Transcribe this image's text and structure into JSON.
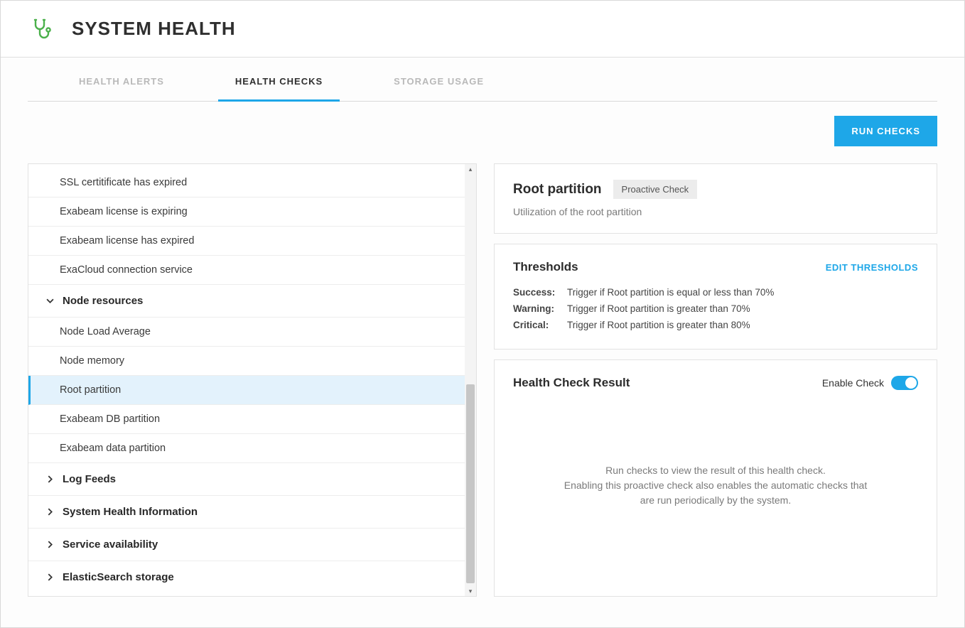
{
  "header": {
    "title": "SYSTEM HEALTH"
  },
  "tabs": [
    {
      "label": "HEALTH ALERTS",
      "active": false
    },
    {
      "label": "HEALTH CHECKS",
      "active": true
    },
    {
      "label": "STORAGE USAGE",
      "active": false
    }
  ],
  "actions": {
    "run_checks": "RUN CHECKS"
  },
  "tree": {
    "leading_leaves": [
      "SSL certitificate has expired",
      "Exabeam license is expiring",
      "Exabeam license has expired",
      "ExaCloud connection service"
    ],
    "group_node_resources": {
      "label": "Node resources",
      "expanded": true,
      "children": [
        "Node Load Average",
        "Node memory",
        "Root partition",
        "Exabeam DB partition",
        "Exabeam data partition"
      ],
      "selected_index": 2
    },
    "closed_groups": [
      "Log Feeds",
      "System Health Information",
      "Service availability",
      "ElasticSearch storage"
    ]
  },
  "detail": {
    "title": "Root partition",
    "badge": "Proactive Check",
    "subtitle": "Utilization of the root partition"
  },
  "thresholds": {
    "title": "Thresholds",
    "edit_label": "EDIT THRESHOLDS",
    "rows": [
      {
        "label": "Success:",
        "text": "Trigger if Root partition is equal or less than 70%"
      },
      {
        "label": "Warning:",
        "text": "Trigger if Root partition is greater than 70%"
      },
      {
        "label": "Critical:",
        "text": "Trigger if Root partition is greater than 80%"
      }
    ]
  },
  "result": {
    "title": "Health Check Result",
    "toggle_label": "Enable Check",
    "toggle_on": true,
    "placeholder_line1": "Run checks to view the result of this health check.",
    "placeholder_line2": "Enabling this proactive check also enables the automatic checks that are run periodically by the system."
  }
}
